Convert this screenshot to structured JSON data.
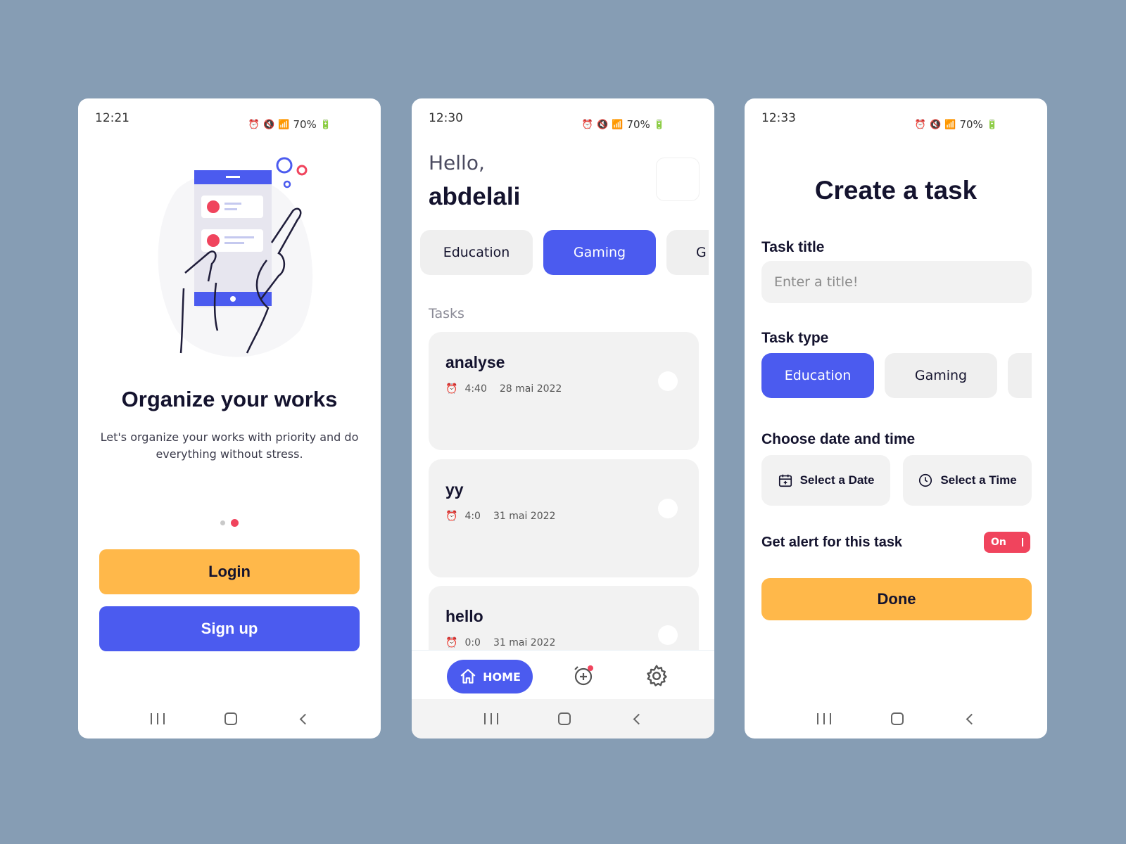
{
  "colors": {
    "background": "#869db4",
    "primary": "#4b5bef",
    "accent_yellow": "#ffb84a",
    "accent_red": "#f0445d"
  },
  "status": {
    "battery": "70%"
  },
  "onboarding": {
    "time": "12:21",
    "title": "Organize your works",
    "subtitle": "Let's organize your works with priority and do everything without stress.",
    "login_label": "Login",
    "signup_label": "Sign up"
  },
  "home": {
    "time": "12:30",
    "greeting": "Hello,",
    "username": "abdelali",
    "categories": [
      "Education",
      "Gaming",
      "G"
    ],
    "tasks_label": "Tasks",
    "tasks": [
      {
        "title": "analyse",
        "time": "4:40",
        "date": "28 mai 2022"
      },
      {
        "title": "yy",
        "time": "4:0",
        "date": "31 mai 2022"
      },
      {
        "title": "hello",
        "time": "0:0",
        "date": "31 mai 2022"
      }
    ],
    "tab_home_label": "HOME"
  },
  "create": {
    "time": "12:33",
    "title": "Create a task",
    "task_title_label": "Task title",
    "task_title_placeholder": "Enter a title!",
    "task_type_label": "Task type",
    "types": [
      "Education",
      "Gaming",
      ""
    ],
    "date_time_label": "Choose date and time",
    "select_date_label": "Select a Date",
    "select_time_label": "Select a Time",
    "alert_label": "Get alert for this task",
    "toggle_label": "On",
    "done_label": "Done"
  }
}
